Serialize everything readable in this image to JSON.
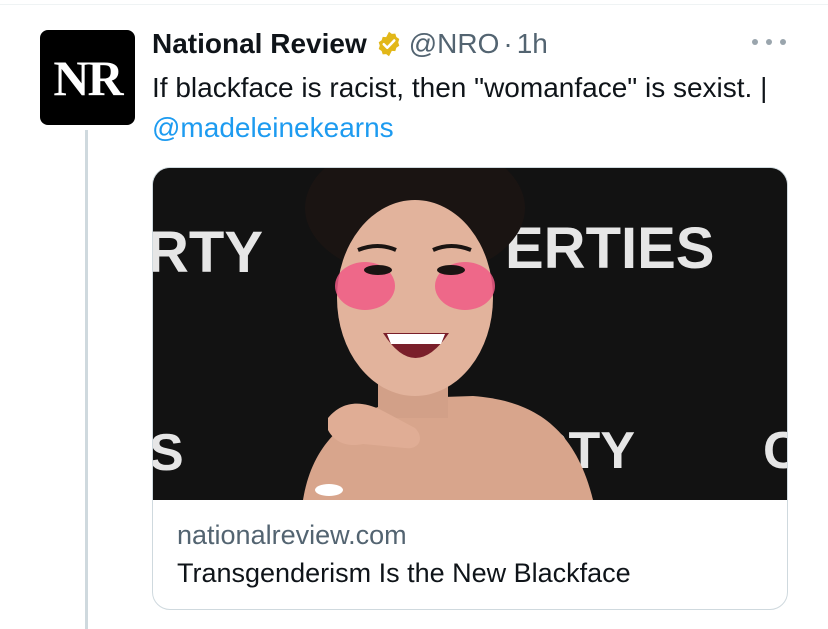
{
  "tweet": {
    "avatar_text": "NR",
    "author_name": "National Review",
    "verified": true,
    "verified_color": "#e2b719",
    "handle": "@NRO",
    "separator": "·",
    "time": "1h",
    "text_prefix": "If blackface is racist, then \"womanface\" is sexist. | ",
    "mention": "@madeleinekearns",
    "link_color": "#1d9bf0"
  },
  "card": {
    "domain": "nationalreview.com",
    "title": "Transgenderism Is the New Blackface",
    "image_backdrop_texts": [
      "RTY",
      "ERTIES",
      "S",
      "RTY",
      "C"
    ],
    "image_icon": "person-photo"
  },
  "icons": {
    "more": "more-horizontal-icon",
    "verified": "verified-badge-icon"
  }
}
